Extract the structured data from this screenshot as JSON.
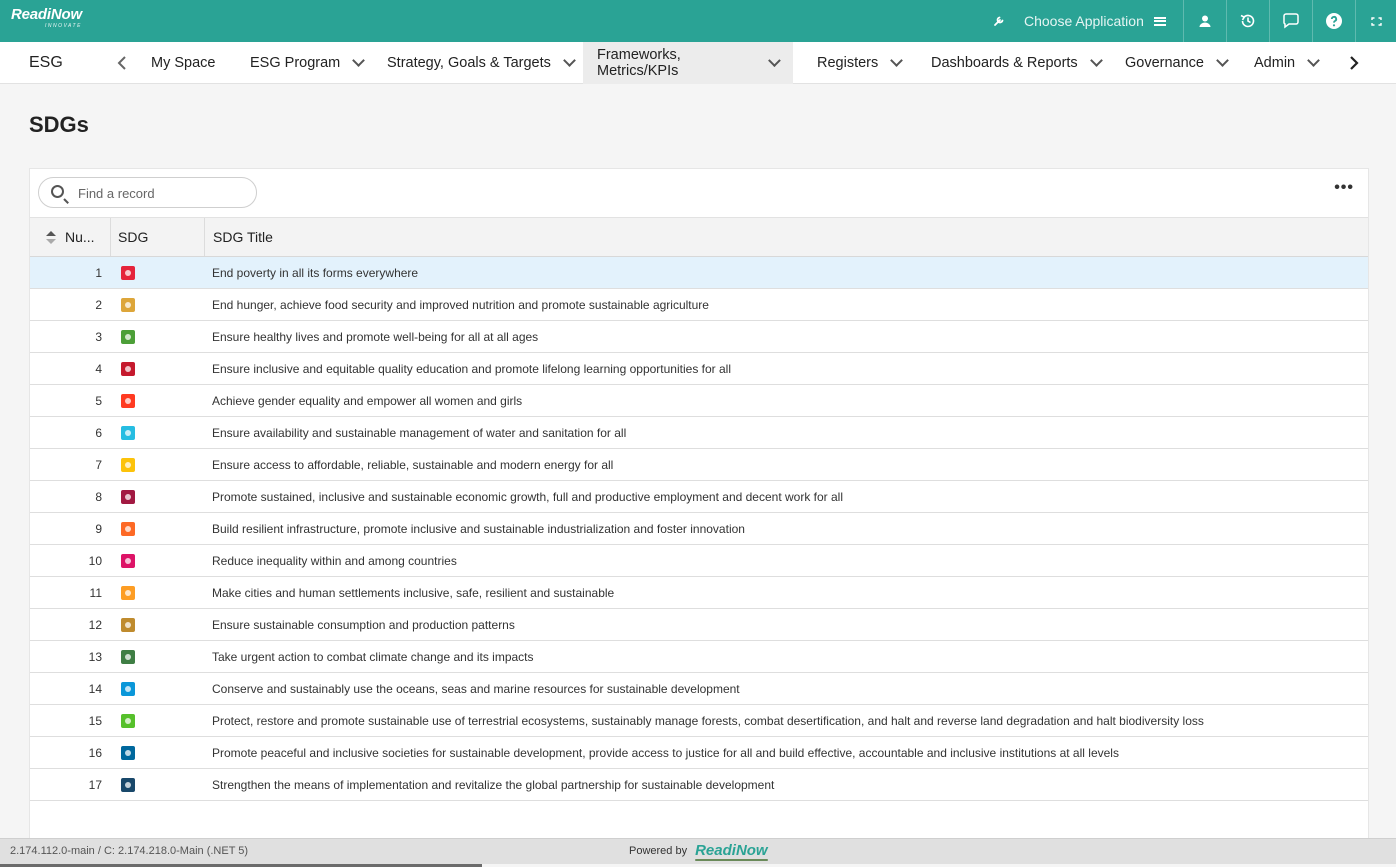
{
  "topbar": {
    "logo_text": "ReadiNow",
    "logo_tag": "INNOVATE",
    "choose_app_label": "Choose Application"
  },
  "navbar": {
    "app_name": "ESG",
    "items": [
      {
        "label": "My Space",
        "has_dropdown": false
      },
      {
        "label": "ESG Program",
        "has_dropdown": true
      },
      {
        "label": "Strategy, Goals & Targets",
        "has_dropdown": true
      },
      {
        "label": "Frameworks, Metrics/KPIs",
        "has_dropdown": true,
        "active": true
      },
      {
        "label": "Registers",
        "has_dropdown": true
      },
      {
        "label": "Dashboards & Reports",
        "has_dropdown": true
      },
      {
        "label": "Governance",
        "has_dropdown": true
      },
      {
        "label": "Admin",
        "has_dropdown": true
      }
    ]
  },
  "page": {
    "title": "SDGs"
  },
  "grid": {
    "search_placeholder": "Find a record",
    "columns": [
      "Nu...",
      "SDG",
      "SDG Title"
    ],
    "rows": [
      {
        "num": "1",
        "color": "#e5243b",
        "title": "End poverty in all its forms everywhere"
      },
      {
        "num": "2",
        "color": "#dda63a",
        "title": "End hunger, achieve food security and improved nutrition and promote sustainable agriculture"
      },
      {
        "num": "3",
        "color": "#4c9f38",
        "title": "Ensure healthy lives and promote well-being for all at all ages"
      },
      {
        "num": "4",
        "color": "#c5192d",
        "title": "Ensure inclusive and equitable quality education and promote lifelong learning opportunities for all"
      },
      {
        "num": "5",
        "color": "#ff3a21",
        "title": "Achieve gender equality and empower all women and girls"
      },
      {
        "num": "6",
        "color": "#26bde2",
        "title": "Ensure availability and sustainable management of water and sanitation for all"
      },
      {
        "num": "7",
        "color": "#fcc30b",
        "title": "Ensure access to affordable, reliable, sustainable and modern energy for all"
      },
      {
        "num": "8",
        "color": "#a21942",
        "title": "Promote sustained, inclusive and sustainable economic growth, full and productive employment and decent work for all"
      },
      {
        "num": "9",
        "color": "#fd6925",
        "title": "Build resilient infrastructure, promote inclusive and sustainable industrialization and foster innovation"
      },
      {
        "num": "10",
        "color": "#dd1367",
        "title": "Reduce inequality within and among countries"
      },
      {
        "num": "11",
        "color": "#fd9d24",
        "title": "Make cities and human settlements inclusive, safe, resilient and sustainable"
      },
      {
        "num": "12",
        "color": "#bf8b2e",
        "title": "Ensure sustainable consumption and production patterns"
      },
      {
        "num": "13",
        "color": "#3f7e44",
        "title": "Take urgent action to combat climate change and its impacts"
      },
      {
        "num": "14",
        "color": "#0a97d9",
        "title": "Conserve and sustainably use the oceans, seas and marine resources for sustainable development"
      },
      {
        "num": "15",
        "color": "#56c02b",
        "title": "Protect, restore and promote sustainable use of terrestrial ecosystems, sustainably manage forests, combat desertification, and halt and reverse land degradation and halt biodiversity loss"
      },
      {
        "num": "16",
        "color": "#00689d",
        "title": "Promote peaceful and inclusive societies for sustainable development, provide access to justice for all and build effective, accountable and inclusive institutions at all levels"
      },
      {
        "num": "17",
        "color": "#19486a",
        "title": "Strengthen the means of implementation and revitalize the global partnership for sustainable development"
      }
    ]
  },
  "footer": {
    "version": "2.174.112.0-main / C: 2.174.218.0-Main (.NET 5)",
    "powered_by": "Powered by",
    "brand": "ReadiNow"
  },
  "colors": {
    "topbar": "#2aa395",
    "selected_row": "#e3f2fc"
  }
}
